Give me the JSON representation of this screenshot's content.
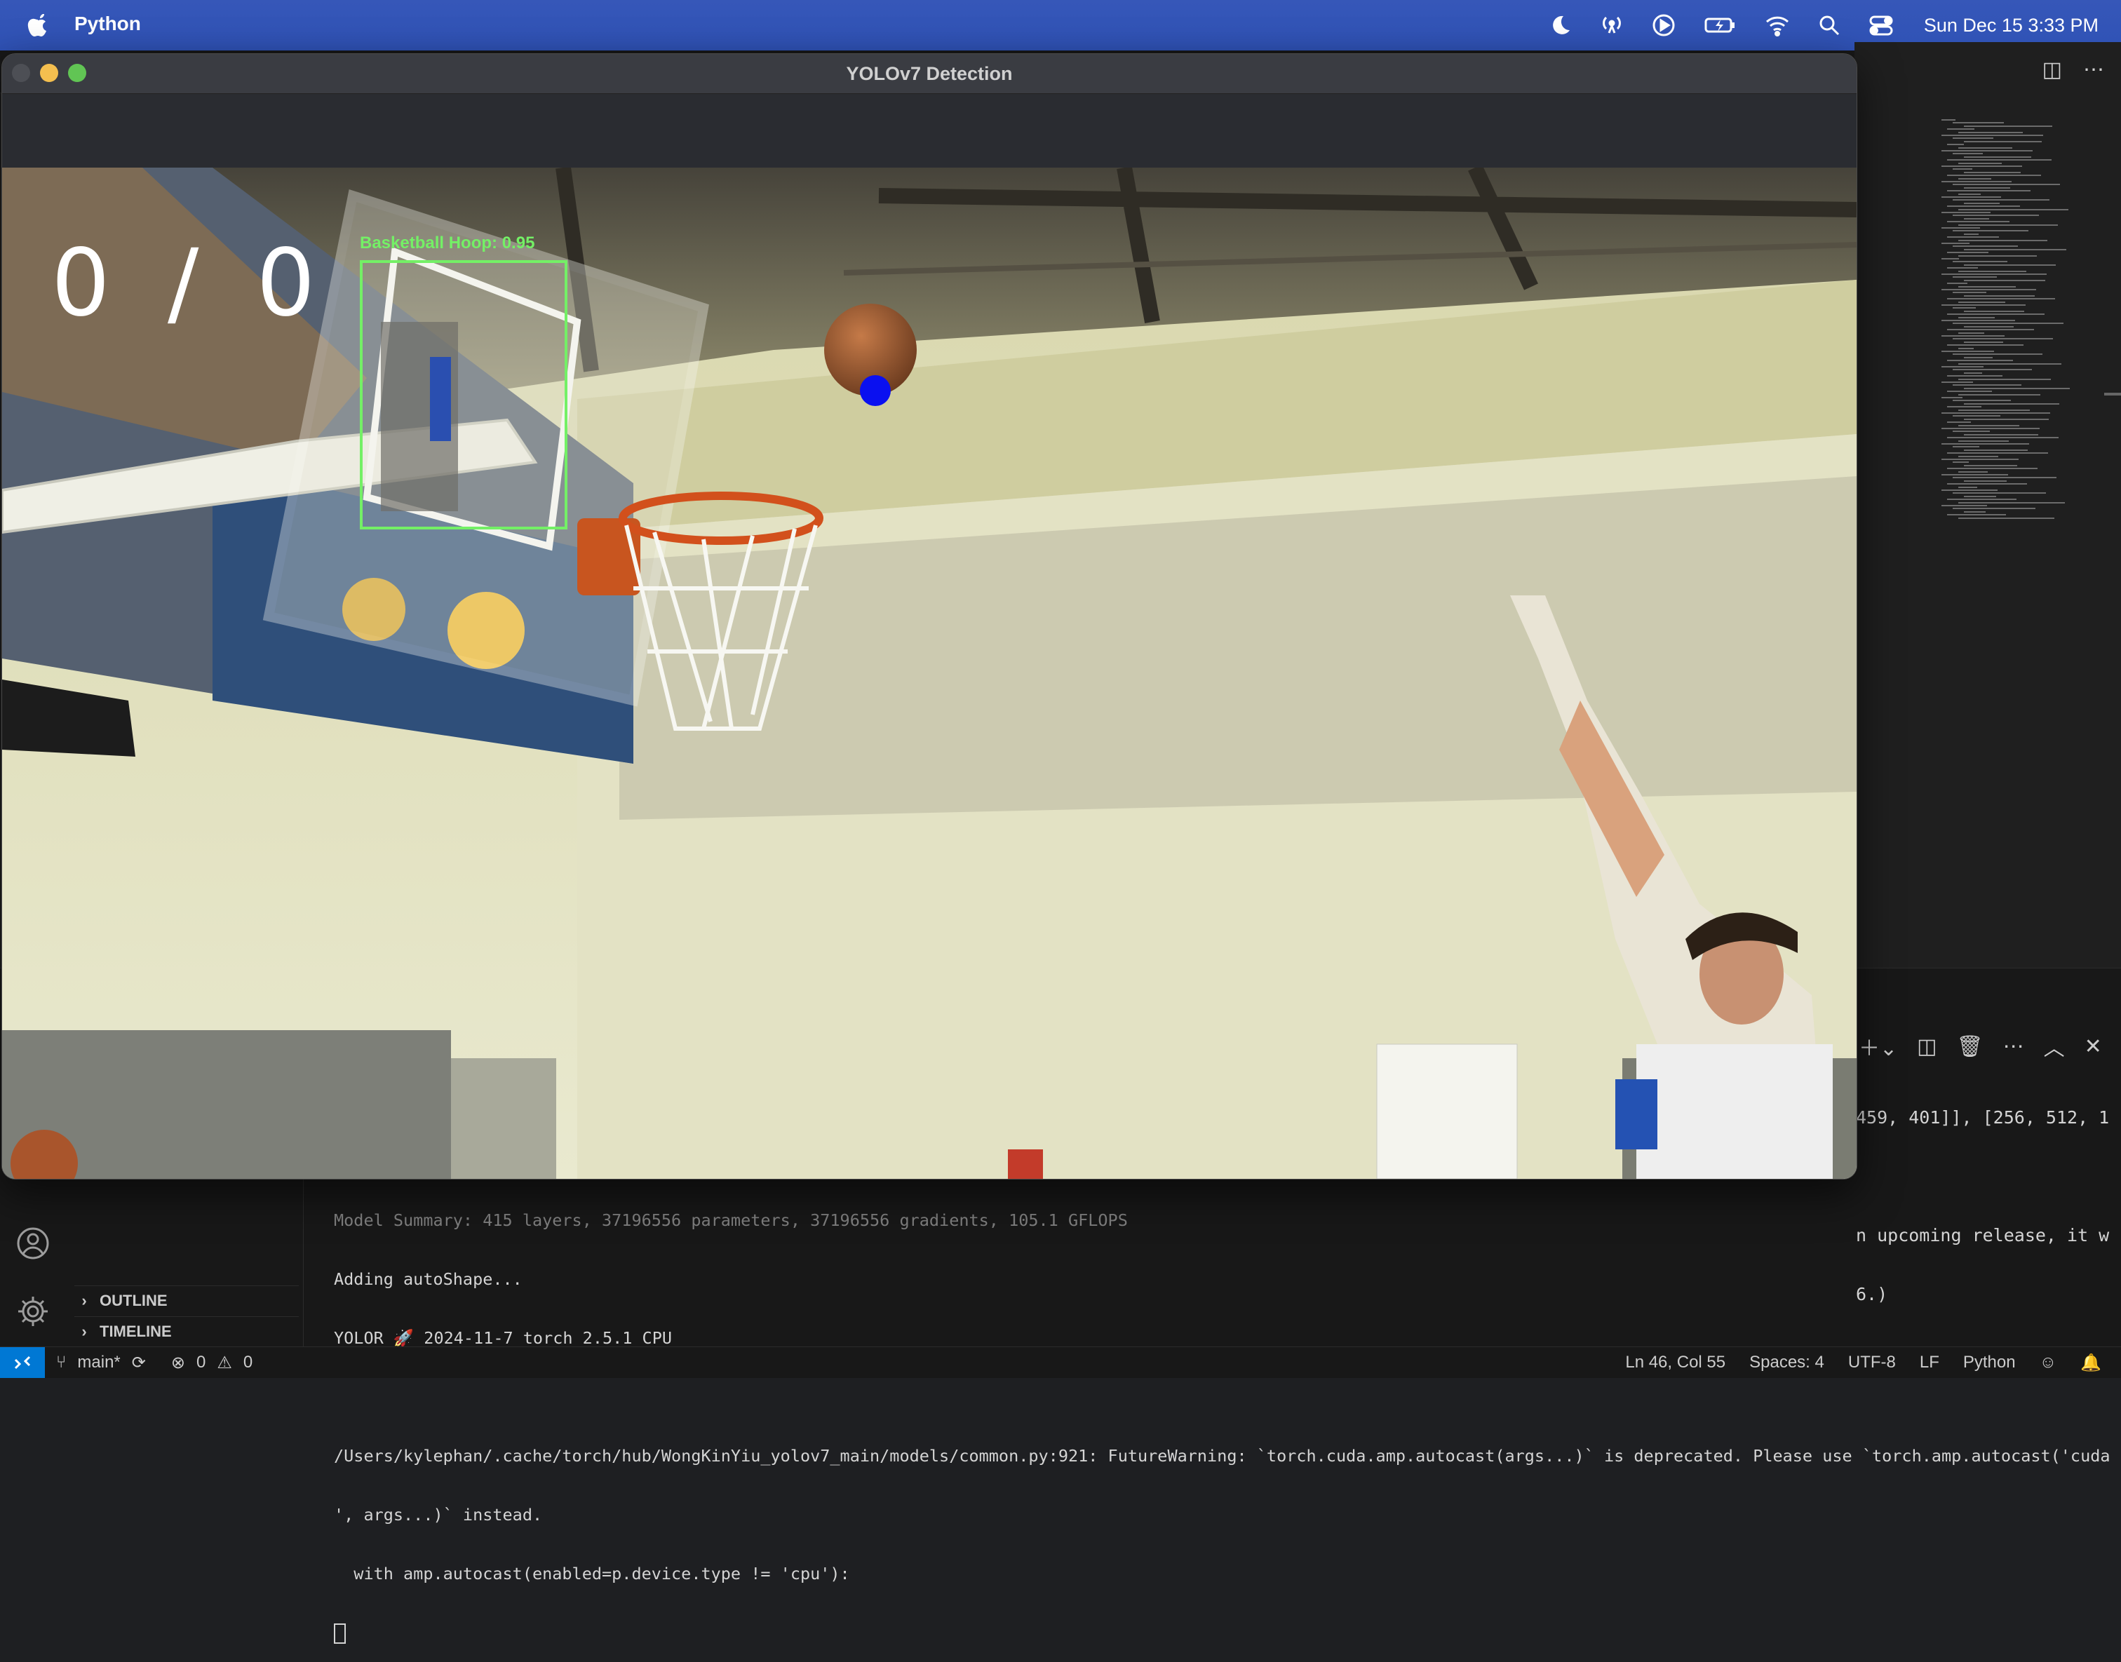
{
  "menubar": {
    "app_name": "Python",
    "clock": "Sun Dec 15  3:33 PM",
    "icons": [
      "moon-icon",
      "broadcast-icon",
      "play-circle-icon",
      "battery-charging-icon",
      "wifi-icon",
      "search-icon",
      "control-center-icon"
    ]
  },
  "yolo_window": {
    "title": "YOLOv7 Detection",
    "score_made": "0",
    "score_separator": "/",
    "score_attempts": "0",
    "detection_label": "Basketball Hoop: 0.95",
    "colors": {
      "detection_box": "#74f066",
      "ball_marker": "#0a10f0"
    }
  },
  "terminal": {
    "clipped_top_line": "Model Summary: 415 layers, 37196556 parameters, 37196556 gradients, 105.1 GFLOPS",
    "line_autoshape": "Adding autoShape...",
    "line_yolor": "YOLOR 🚀 2024-11-7 torch 2.5.1 CPU",
    "warning_1": "/Users/kylephan/.cache/torch/hub/WongKinYiu_yolov7_main/models/common.py:921: FutureWarning: `torch.cuda.amp.autocast(args...)` is deprecated. Please use `torch.amp.autocast('cuda",
    "warning_2": "', args...)` instead.",
    "warning_3": "  with amp.autocast(enabled=p.device.type != 'cpu'):",
    "right_line_1": "459, 401]], [256, 512, 1",
    "right_line_2": "n upcoming release, it w",
    "right_line_3": "6.)"
  },
  "sidebar": {
    "outline_label": "OUTLINE",
    "timeline_label": "TIMELINE"
  },
  "statusbar": {
    "branch": "main*",
    "errors": "0",
    "warnings": "0",
    "position": "Ln 46, Col 55",
    "spaces": "Spaces: 4",
    "encoding": "UTF-8",
    "eol": "LF",
    "language": "Python"
  }
}
